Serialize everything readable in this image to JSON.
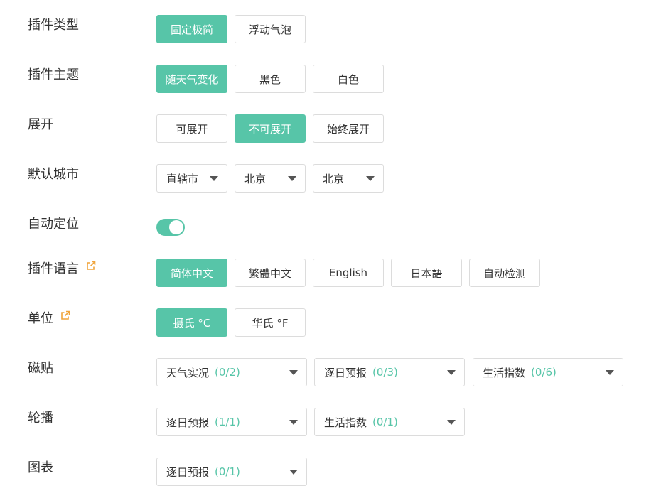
{
  "accent_color": "#57c5a8",
  "external_link_color": "#f0a43a",
  "plugin_type": {
    "label": "插件类型",
    "options": [
      "固定极简",
      "浮动气泡"
    ],
    "selected": "固定极简"
  },
  "plugin_theme": {
    "label": "插件主题",
    "options": [
      "随天气变化",
      "黑色",
      "白色"
    ],
    "selected": "随天气变化"
  },
  "expand": {
    "label": "展开",
    "options": [
      "可展开",
      "不可展开",
      "始终展开"
    ],
    "selected": "不可展开"
  },
  "default_city": {
    "label": "默认城市",
    "province": "直辖市",
    "city": "北京",
    "district": "北京"
  },
  "auto_locate": {
    "label": "自动定位",
    "enabled": true
  },
  "plugin_language": {
    "label": "插件语言",
    "icon": "external-link-icon",
    "options": [
      "简体中文",
      "繁體中文",
      "English",
      "日本語",
      "自动检测"
    ],
    "selected": "简体中文"
  },
  "unit": {
    "label": "单位",
    "icon": "external-link-icon",
    "options": [
      "摄氏 °C",
      "华氏 °F"
    ],
    "selected": "摄氏 °C"
  },
  "tiles": {
    "label": "磁贴",
    "selects": [
      {
        "name": "天气实况",
        "count": "(0/2)"
      },
      {
        "name": "逐日预报",
        "count": "(0/3)"
      },
      {
        "name": "生活指数",
        "count": "(0/6)"
      }
    ]
  },
  "carousel": {
    "label": "轮播",
    "selects": [
      {
        "name": "逐日预报",
        "count": "(1/1)"
      },
      {
        "name": "生活指数",
        "count": "(0/1)"
      }
    ]
  },
  "chart": {
    "label": "图表",
    "selects": [
      {
        "name": "逐日预报",
        "count": "(0/1)"
      }
    ]
  }
}
